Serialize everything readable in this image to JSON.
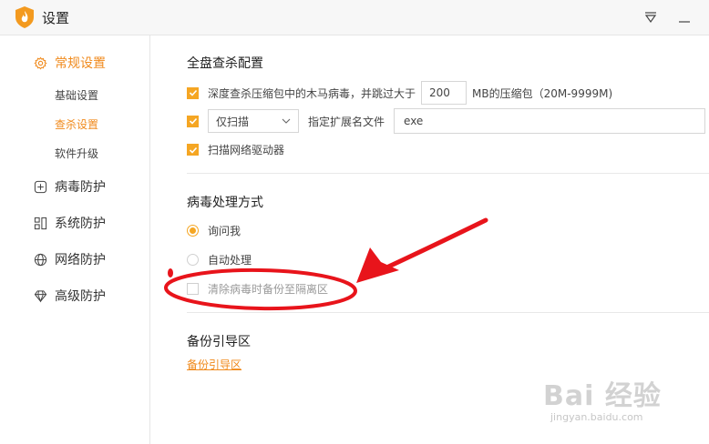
{
  "window": {
    "title": "设置",
    "dropdown_icon": "dropdown-triangle-icon",
    "minimize_icon": "minimize-icon"
  },
  "sidebar": {
    "items": [
      {
        "label": "常规设置",
        "icon": "gear-icon",
        "active": true
      },
      {
        "label": "病毒防护",
        "icon": "plus-square-icon"
      },
      {
        "label": "系统防护",
        "icon": "grid-icon"
      },
      {
        "label": "网络防护",
        "icon": "globe-icon"
      },
      {
        "label": "高级防护",
        "icon": "diamond-icon"
      }
    ],
    "subitems": [
      {
        "label": "基础设置"
      },
      {
        "label": "查杀设置",
        "active": true
      },
      {
        "label": "软件升级"
      }
    ]
  },
  "main": {
    "full_scan": {
      "title": "全盘查杀配置",
      "deep_scan": {
        "label_before": "深度查杀压缩包中的木马病毒，并跳过大于",
        "value": "200",
        "label_after": "MB的压缩包（20M-9999M)",
        "checked": true
      },
      "scan_mode": {
        "selected": "仅扫描",
        "label": "指定扩展名文件",
        "ext_value": "exe",
        "checked": true
      },
      "network_drive": {
        "label": "扫描网络驱动器",
        "checked": true
      }
    },
    "virus_handling": {
      "title": "病毒处理方式",
      "options": [
        {
          "label": "询问我",
          "selected": true
        },
        {
          "label": "自动处理",
          "selected": false
        }
      ],
      "backup": {
        "label": "清除病毒时备份至隔离区",
        "checked": false
      }
    },
    "backup_guide": {
      "title": "备份引导区",
      "link": "备份引导区"
    }
  },
  "watermark": {
    "main": "Bai 经验",
    "url": "jingyan.baidu.com"
  },
  "colors": {
    "accent": "#f08a1c",
    "checkbox": "#f5a623",
    "annotation": "#e8141b"
  }
}
